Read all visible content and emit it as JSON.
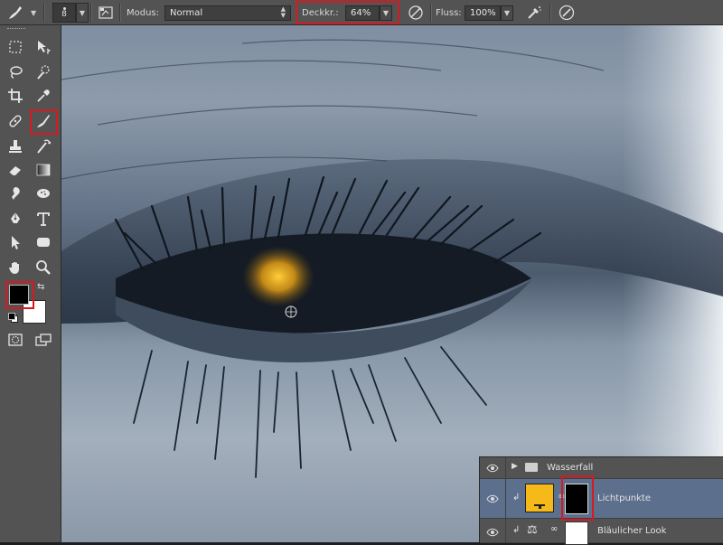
{
  "options_bar": {
    "brush_size": "8",
    "mode_label": "Modus:",
    "mode_value": "Normal",
    "opacity_label": "Deckkr.:",
    "opacity_value": "64%",
    "flow_label": "Fluss:",
    "flow_value": "100%"
  },
  "toolbar": {
    "tools": [
      "move-tool",
      "marquee-tool",
      "lasso-tool",
      "quick-selection-tool",
      "crop-tool",
      "eyedropper-tool",
      "healing-brush-tool",
      "brush-tool",
      "clone-stamp-tool",
      "history-brush-tool",
      "eraser-tool",
      "gradient-tool",
      "blur-tool",
      "dodge-tool",
      "pen-tool",
      "type-tool",
      "path-selection-tool",
      "rectangle-tool",
      "hand-tool",
      "zoom-tool",
      "quick-mask-tool",
      "screen-mode-tool"
    ],
    "selected_tool": "brush-tool",
    "foreground_color": "#000000",
    "background_color": "#ffffff"
  },
  "layers": [
    {
      "name": "Wasserfall",
      "type": "group",
      "visible": true
    },
    {
      "name": "Lichtpunkte",
      "type": "fill",
      "fill_color": "#f6b91a",
      "has_mask": true,
      "mask_color": "#000000",
      "selected": true,
      "visible": true
    },
    {
      "name": "Bläulicher Look",
      "type": "adjustment",
      "has_mask": true,
      "mask_color": "#ffffff",
      "visible": true
    }
  ],
  "highlight_color": "#d71920",
  "accent_glow_color": "#f2b21e"
}
